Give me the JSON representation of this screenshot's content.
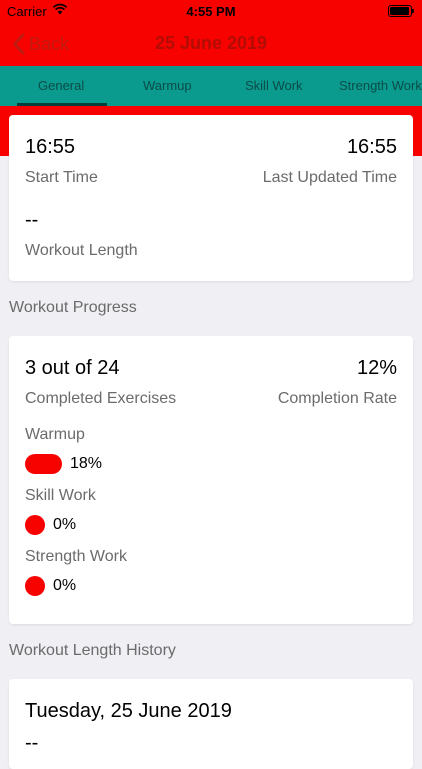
{
  "status_bar": {
    "carrier": "Carrier",
    "time": "4:55 PM"
  },
  "nav": {
    "back_label": "Back",
    "title": "25 June 2019"
  },
  "tabs": [
    {
      "label": "General",
      "selected": true
    },
    {
      "label": "Warmup",
      "selected": false
    },
    {
      "label": "Skill Work",
      "selected": false
    },
    {
      "label": "Strength Work",
      "selected": false
    }
  ],
  "general_card": {
    "start_time": "16:55",
    "start_time_label": "Start Time",
    "last_updated_time": "16:55",
    "last_updated_label": "Last Updated Time",
    "workout_length": "--",
    "workout_length_label": "Workout Length"
  },
  "workout_progress": {
    "section_title": "Workout Progress",
    "completed_exercises": "3 out of 24",
    "completed_exercises_label": "Completed Exercises",
    "completion_rate": "12%",
    "completion_rate_label": "Completion Rate",
    "items": [
      {
        "name": "Warmup",
        "percent_text": "18%",
        "fraction": 0.18
      },
      {
        "name": "Skill Work",
        "percent_text": "0%",
        "fraction": 0.0
      },
      {
        "name": "Strength Work",
        "percent_text": "0%",
        "fraction": 0.0
      }
    ]
  },
  "history": {
    "section_title": "Workout Length History",
    "date": "Tuesday, 25 June 2019",
    "length": "--"
  },
  "colors": {
    "accent_red": "#f80200",
    "tab_teal": "#0a9a8e",
    "back_red": "#c11a10"
  }
}
